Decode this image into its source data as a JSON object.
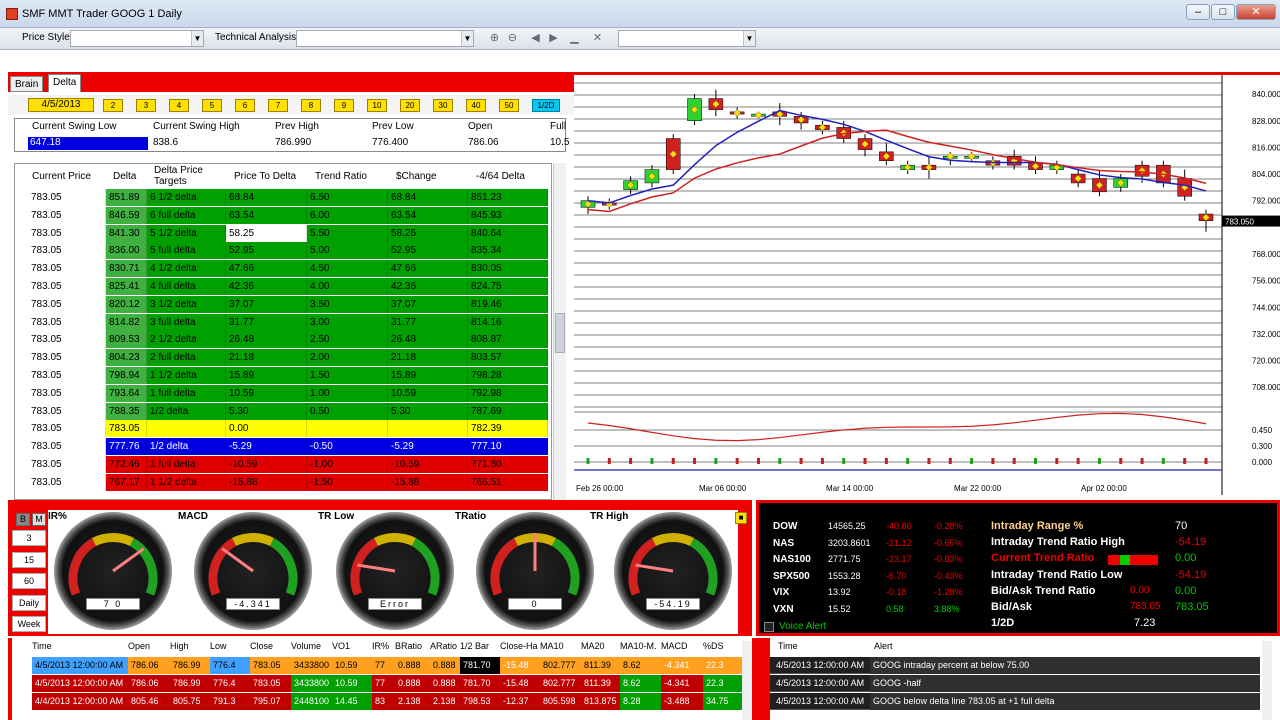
{
  "window": {
    "title": "SMF MMT Trader GOOG  1 Daily"
  },
  "toolbar": {
    "price_style_label": "Price Style",
    "technical_analysis_label": "Technical Analysis"
  },
  "tabs": [
    "Brain",
    "Delta"
  ],
  "date_button": "4/5/2013",
  "number_buttons": [
    "2",
    "3",
    "4",
    "5",
    "6",
    "7",
    "8",
    "9",
    "10",
    "20",
    "30",
    "40",
    "50",
    "1/2D"
  ],
  "swing": {
    "headers": [
      "Current Swing Low",
      "Current Swing High",
      "Prev High",
      "Prev Low",
      "Open",
      "Full"
    ],
    "values": [
      "647.18",
      "838.6",
      "786.990",
      "776.400",
      "786.06",
      "10.5"
    ]
  },
  "grid_headers": [
    "Current Price",
    "Delta",
    "Delta Price Targets",
    "Price To Delta",
    "Trend Ratio",
    "$Change",
    "-4/64 Delta"
  ],
  "grid_rows": [
    {
      "c": "783.05",
      "d": "851.89",
      "t": "6 1/2 delta",
      "p": "68.84",
      "r": "6.50",
      "s": "68.84",
      "n": "851.23",
      "color": "g"
    },
    {
      "c": "783.05",
      "d": "846.59",
      "t": "6 full delta",
      "p": "63.54",
      "r": "6.00",
      "s": "63.54",
      "n": "845.93",
      "color": "g"
    },
    {
      "c": "783.05",
      "d": "841.30",
      "t": "5 1/2 delta",
      "p": "58.25",
      "r": "5.50",
      "s": "58.25",
      "n": "840.64",
      "color": "g",
      "sel": true
    },
    {
      "c": "783.05",
      "d": "836.00",
      "t": "5 full delta",
      "p": "52.95",
      "r": "5.00",
      "s": "52.95",
      "n": "835.34",
      "color": "g"
    },
    {
      "c": "783.05",
      "d": "830.71",
      "t": "4 1/2 delta",
      "p": "47.66",
      "r": "4.50",
      "s": "47.66",
      "n": "830.05",
      "color": "g"
    },
    {
      "c": "783.05",
      "d": "825.41",
      "t": "4 full delta",
      "p": "42.36",
      "r": "4.00",
      "s": "42.36",
      "n": "824.75",
      "color": "g"
    },
    {
      "c": "783.05",
      "d": "820.12",
      "t": "3 1/2 delta",
      "p": "37.07",
      "r": "3.50",
      "s": "37.07",
      "n": "819.46",
      "color": "g"
    },
    {
      "c": "783.05",
      "d": "814.82",
      "t": "3 full delta",
      "p": "31.77",
      "r": "3.00",
      "s": "31.77",
      "n": "814.16",
      "color": "g"
    },
    {
      "c": "783.05",
      "d": "809.53",
      "t": "2 1/2 delta",
      "p": "26.48",
      "r": "2.50",
      "s": "26.48",
      "n": "808.87",
      "color": "g"
    },
    {
      "c": "783.05",
      "d": "804.23",
      "t": "2 full delta",
      "p": "21.18",
      "r": "2.00",
      "s": "21.18",
      "n": "803.57",
      "color": "g"
    },
    {
      "c": "783.05",
      "d": "798.94",
      "t": "1 1/2 delta",
      "p": "15.89",
      "r": "1.50",
      "s": "15.89",
      "n": "798.28",
      "color": "g"
    },
    {
      "c": "783.05",
      "d": "793.64",
      "t": "1 full delta",
      "p": "10.59",
      "r": "1.00",
      "s": "10.59",
      "n": "792.98",
      "color": "g"
    },
    {
      "c": "783.05",
      "d": "788.35",
      "t": "1/2 delta",
      "p": "5.30",
      "r": "0.50",
      "s": "5.30",
      "n": "787.69",
      "color": "g"
    },
    {
      "c": "783.05",
      "d": "783.05",
      "t": "",
      "p": "0.00",
      "r": "",
      "s": "",
      "n": "782.39",
      "color": "y"
    },
    {
      "c": "783.05",
      "d": "777.76",
      "t": "1/2 delta",
      "p": "-5.29",
      "r": "-0.50",
      "s": "-5.29",
      "n": "777.10",
      "color": "b"
    },
    {
      "c": "783.05",
      "d": "772.46",
      "t": "1 full delta",
      "p": "-10.59",
      "r": "-1.00",
      "s": "-10.59",
      "n": "771.80",
      "color": "r"
    },
    {
      "c": "783.05",
      "d": "767.17",
      "t": "1 1/2 delta",
      "p": "-15.88",
      "r": "-1.50",
      "s": "-15.88",
      "n": "766.51",
      "color": "r"
    }
  ],
  "chart_data": {
    "type": "candlestick",
    "x": [
      "Feb 26 00:00",
      "Mar 06 00:00",
      "Mar 14 00:00",
      "Mar 22 00:00",
      "Apr 02 00:00"
    ],
    "y_ticks": [
      "840.000",
      "828.000",
      "816.000",
      "804.000",
      "792.000",
      "783.050",
      "768.000",
      "756.000",
      "744.000",
      "732.000",
      "720.000",
      "708.000"
    ],
    "ylim": [
      700,
      845
    ],
    "current": "783.050",
    "candles": [
      [
        789,
        792,
        794,
        786
      ],
      [
        791,
        790,
        793,
        788
      ],
      [
        797,
        801,
        803,
        795
      ],
      [
        800,
        806,
        808,
        798
      ],
      [
        820,
        806,
        822,
        804
      ],
      [
        828,
        838,
        840,
        826
      ],
      [
        838,
        833,
        842,
        830
      ],
      [
        832,
        831,
        834,
        829
      ],
      [
        830,
        831,
        832,
        829
      ],
      [
        832,
        830,
        836,
        826
      ],
      [
        830,
        827,
        832,
        824
      ],
      [
        826,
        824,
        828,
        822
      ],
      [
        825,
        820,
        828,
        818
      ],
      [
        820,
        815,
        822,
        812
      ],
      [
        814,
        810,
        818,
        808
      ],
      [
        806,
        808,
        810,
        804
      ],
      [
        808,
        806,
        812,
        802
      ],
      [
        812,
        812,
        814,
        808
      ],
      [
        812,
        812,
        814,
        810
      ],
      [
        810,
        808,
        812,
        806
      ],
      [
        812,
        808,
        815,
        806
      ],
      [
        809,
        806,
        812,
        804
      ],
      [
        806,
        808,
        810,
        804
      ],
      [
        804,
        800,
        806,
        798
      ],
      [
        802,
        796,
        806,
        794
      ],
      [
        798,
        802,
        804,
        796
      ],
      [
        808,
        803,
        810,
        800
      ],
      [
        808,
        800,
        810,
        798
      ],
      [
        802,
        794,
        806,
        792
      ],
      [
        786,
        783,
        788,
        778
      ]
    ],
    "osc_ticks": [
      "0.450",
      "0.300",
      "0.000"
    ]
  },
  "gauges": [
    {
      "label": "IR%",
      "value": "7 0",
      "level": 0.7
    },
    {
      "label": "MACD",
      "value": "-4.341",
      "level": 0.3
    },
    {
      "label": "TR Low",
      "value": "Error",
      "level": 0.2
    },
    {
      "label": "TRatio",
      "value": "0",
      "level": 0.5
    },
    {
      "label": "TR High",
      "value": "-54.19",
      "level": 0.2
    }
  ],
  "side_buttons": [
    "B",
    "M",
    "3",
    "15",
    "60",
    "Daily",
    "Week"
  ],
  "indices": [
    {
      "n": "DOW",
      "v": "14565.25",
      "c": "-40.86",
      "p": "-0.28%"
    },
    {
      "n": "NAS",
      "v": "3203.8601",
      "c": "-21.12",
      "p": "-0.65%"
    },
    {
      "n": "NAS100",
      "v": "2771.75",
      "c": "-23.17",
      "p": "-0.83%"
    },
    {
      "n": "SPX500",
      "v": "1553.28",
      "c": "-6.70",
      "p": "-0.43%"
    },
    {
      "n": "VIX",
      "v": "13.92",
      "c": "-0.18",
      "p": "-1.28%"
    },
    {
      "n": "VXN",
      "v": "15.52",
      "c": "0.58",
      "p": "3.88%"
    }
  ],
  "voice_alert": "Voice Alert",
  "stats": [
    {
      "l": "Intraday Range %",
      "v": "70"
    },
    {
      "l": "Intraday Trend Ratio High",
      "v": "-54.19"
    },
    {
      "l": "Current Trend Ratio",
      "v": "0.00"
    },
    {
      "l": "Intraday Trend Ratio Low",
      "v": "-54.19"
    },
    {
      "l": "Bid/Ask Trend Ratio",
      "v": "0.00",
      "v0": "0.00"
    },
    {
      "l": "Bid/Ask",
      "v": "783.05",
      "v0": "783.05"
    },
    {
      "l": "1/2D",
      "v": "7.23"
    }
  ],
  "bars_headers": [
    "Time",
    "Open",
    "High",
    "Low",
    "Close",
    "Volume",
    "VO1",
    "IR%",
    "BRatio",
    "ARatio",
    "1/2 Bar",
    "Close-Ha",
    "MA10",
    "MA20",
    "MA10-M.",
    "MACD",
    "%DS"
  ],
  "bars": [
    [
      "4/5/2013 12:00:00 AM",
      "786.06",
      "786.99",
      "776.4",
      "783.05",
      "3433800",
      "10.59",
      "77",
      "0.888",
      "0.888",
      "781.70",
      "-15.48",
      "802.777",
      "811.39",
      "8.62",
      "-4.341",
      "22.3"
    ],
    [
      "4/5/2013 12:00:00 AM",
      "786.06",
      "786.99",
      "776.4",
      "783.05",
      "3433800",
      "10.59",
      "77",
      "0.888",
      "0.888",
      "781.70",
      "-15.48",
      "802.777",
      "811.39",
      "8.62",
      "-4.341",
      "22.3"
    ],
    [
      "4/4/2013 12:00:00 AM",
      "805.46",
      "805.75",
      "791.3",
      "795.07",
      "2448100",
      "14.45",
      "83",
      "2.138",
      "2.138",
      "798.53",
      "-12.37",
      "805.598",
      "813.875",
      "8.28",
      "-3.488",
      "34.75"
    ]
  ],
  "alerts_headers": [
    "Time",
    "Alert"
  ],
  "alerts": [
    [
      "4/5/2013 12:00:00 AM",
      "GOOG intraday percent at below 75.00"
    ],
    [
      "4/5/2013 12:00:00 AM",
      "GOOG -half"
    ],
    [
      "4/5/2013 12:00:00 AM",
      "GOOG below delta line 783.05 at +1 full delta"
    ]
  ]
}
